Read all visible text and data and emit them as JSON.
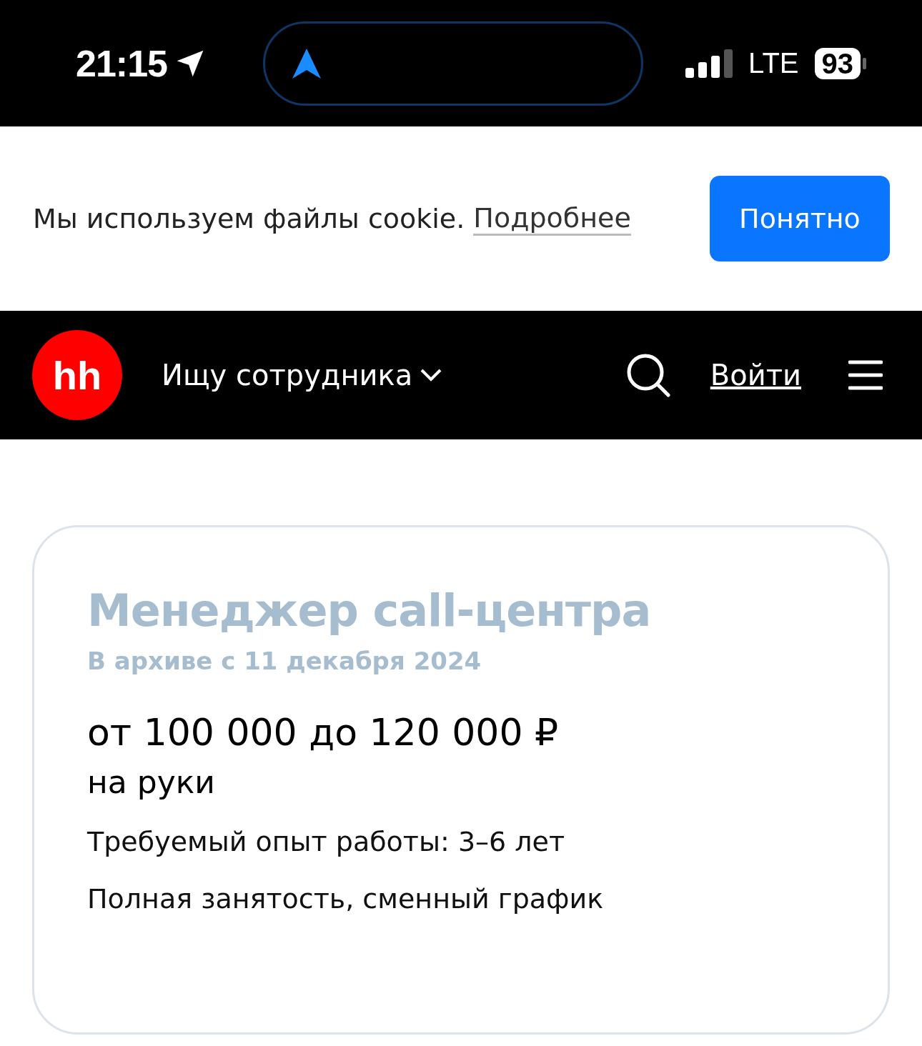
{
  "status_bar": {
    "time": "21:15",
    "network": "LTE",
    "battery": "93"
  },
  "cookie_banner": {
    "text": "Мы используем файлы cookie.",
    "link": "Подробнее",
    "button": "Понятно"
  },
  "header": {
    "logo": "hh",
    "role_selector": "Ищу сотрудника",
    "login": "Войти"
  },
  "vacancy": {
    "title": "Менеджер call-центра",
    "archived": "В архиве с 11 декабря 2024",
    "salary": "от 100 000 до 120 000 ₽",
    "salary_note": "на руки",
    "details": [
      "Требуемый опыт работы: 3–6 лет",
      "Полная занятость, сменный график"
    ]
  }
}
